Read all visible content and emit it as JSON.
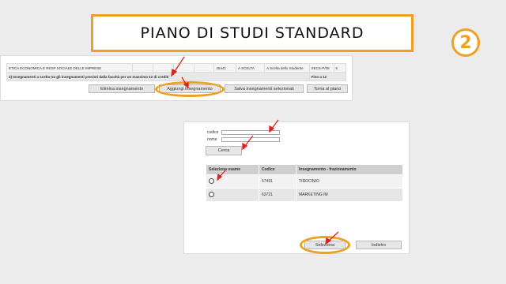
{
  "title": "PIANO DI STUDI STANDARD",
  "step_badge": "2",
  "accent_color": "#f0a020",
  "pointer_color": "#e02020",
  "panel1": {
    "row1": [
      "ETICA ECONOMICA E RESP SOCIALE DELLE IMPRESE",
      "",
      "",
      "",
      "",
      "45441",
      "A SCELTA",
      "A Scelta dello Studente",
      "SECS-P/08",
      "6"
    ],
    "row2": {
      "text": "3) Insegnamenti a scelta tra gli insegnamenti previsti dalla facoltà per un massimo 12 di crediti",
      "right": "Fino a 12"
    },
    "buttons": {
      "elimina": "Elimina insegnamento",
      "aggiungi": "Aggiungi insegnamento",
      "salva": "Salva insegnamenti selezionati",
      "torna": "Torna al piano"
    }
  },
  "panel2": {
    "codice_label": "codice",
    "nome_label": "nome",
    "codice_value": "",
    "nome_value": "",
    "cerca_button": "Cerca",
    "table": {
      "headers": [
        "Seleziona esame",
        "Codice",
        "Insegnamento - frazionamento"
      ],
      "rows": [
        {
          "codice": "57491",
          "nome": "TIROCINIO"
        },
        {
          "codice": "63721",
          "nome": "MARKETING IM"
        }
      ]
    },
    "seleziona_button": "Seleziona",
    "indietro_button": "Indietro"
  }
}
